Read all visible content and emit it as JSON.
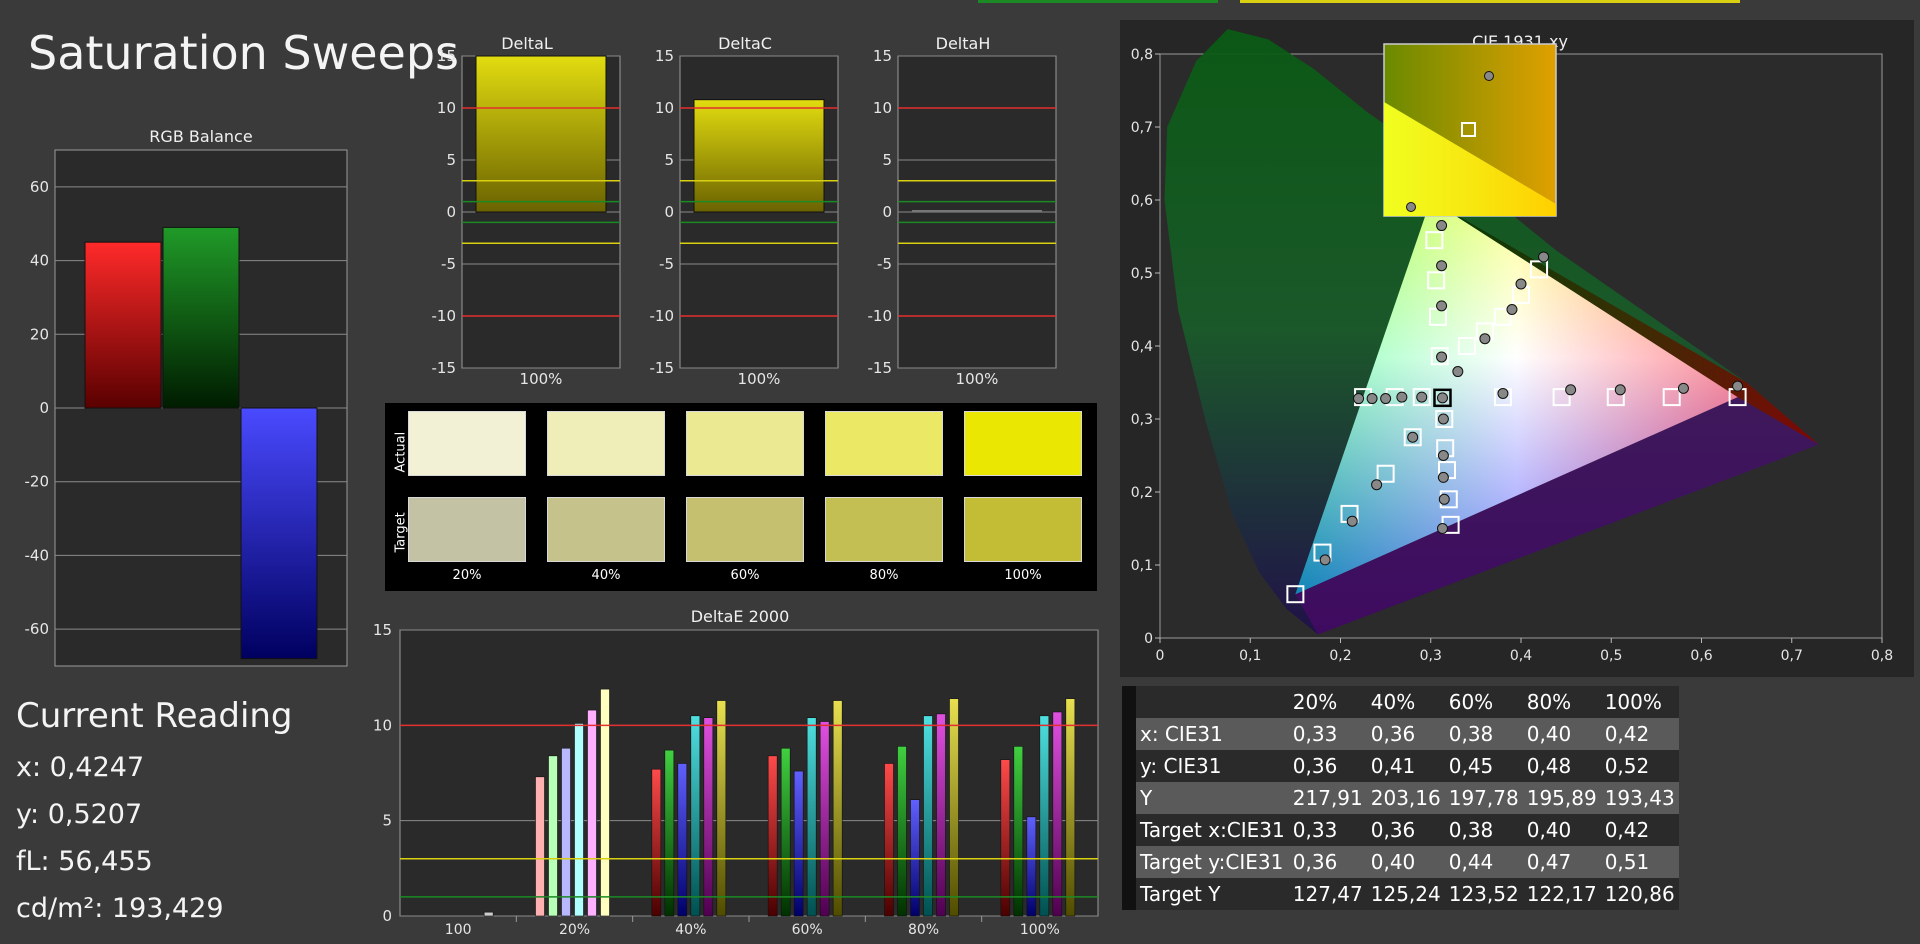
{
  "title": "Saturation Sweeps",
  "current_reading": {
    "heading": "Current Reading",
    "x": "x: 0,4247",
    "y": "y: 0,5207",
    "fl": "fL: 56,455",
    "cdm2": "cd/m²: 193,429"
  },
  "colors": {
    "red": "#e8202a",
    "green": "#1c8a24",
    "blue": "#2a28ff",
    "yellow": "#d8d010",
    "bg": "#2a2a2a"
  },
  "chart_data": [
    {
      "type": "bar",
      "title": "RGB Balance",
      "categories": [
        "100%"
      ],
      "series": [
        {
          "name": "R",
          "values": [
            45
          ]
        },
        {
          "name": "G",
          "values": [
            49
          ]
        },
        {
          "name": "B",
          "values": [
            -68
          ]
        }
      ],
      "ylim": [
        -70,
        70
      ],
      "yticks": [
        60,
        40,
        20,
        0,
        -20,
        -40,
        -60
      ],
      "grid": true
    },
    {
      "type": "bar",
      "title": "DeltaL",
      "categories": [
        "100%"
      ],
      "values": [
        15
      ],
      "ylim": [
        -15,
        15
      ],
      "yticks": [
        15,
        10,
        5,
        0,
        -5,
        -10,
        -15
      ]
    },
    {
      "type": "bar",
      "title": "DeltaC",
      "categories": [
        "100%"
      ],
      "values": [
        10.8
      ],
      "ylim": [
        -15,
        15
      ],
      "yticks": [
        15,
        10,
        5,
        0,
        -5,
        -10,
        -15
      ]
    },
    {
      "type": "bar",
      "title": "DeltaH",
      "categories": [
        "100%"
      ],
      "values": [
        0.1
      ],
      "ylim": [
        -15,
        15
      ],
      "yticks": [
        15,
        10,
        5,
        0,
        -5,
        -10,
        -15
      ]
    },
    {
      "type": "bar",
      "title": "DeltaE 2000",
      "categories": [
        "100",
        "20%",
        "40%",
        "60%",
        "80%",
        "100%"
      ],
      "series": [
        {
          "name": "R",
          "values": [
            0,
            7.3,
            7.7,
            8.4,
            8.0,
            8.2
          ]
        },
        {
          "name": "G",
          "values": [
            0,
            8.4,
            8.7,
            8.8,
            8.9,
            8.9
          ]
        },
        {
          "name": "B",
          "values": [
            0,
            8.8,
            8.0,
            7.6,
            6.1,
            5.2
          ]
        },
        {
          "name": "C",
          "values": [
            0,
            10.1,
            10.5,
            10.4,
            10.5,
            10.5
          ]
        },
        {
          "name": "M",
          "values": [
            0,
            10.8,
            10.4,
            10.2,
            10.6,
            10.7
          ]
        },
        {
          "name": "Y",
          "values": [
            0.2,
            11.9,
            11.3,
            11.3,
            11.4,
            11.4
          ]
        }
      ],
      "ylim": [
        0,
        15
      ],
      "yticks": [
        15,
        10,
        5,
        0
      ]
    },
    {
      "type": "scatter",
      "title": "CIE 1931 xy",
      "xlabel": "",
      "ylabel": "",
      "xlim": [
        0,
        0.8
      ],
      "ylim": [
        0,
        0.8
      ],
      "xticks": [
        "0",
        "0,1",
        "0,2",
        "0,3",
        "0,4",
        "0,5",
        "0,6",
        "0,7",
        "0,8"
      ],
      "yticks": [
        "0",
        "0,1",
        "0,2",
        "0,3",
        "0,4",
        "0,5",
        "0,6",
        "0,7",
        "0,8"
      ],
      "gamut": [
        [
          0.64,
          0.33
        ],
        [
          0.3,
          0.6
        ],
        [
          0.15,
          0.06
        ]
      ],
      "targets": [
        [
          0.313,
          0.329
        ],
        [
          0.38,
          0.33
        ],
        [
          0.445,
          0.33
        ],
        [
          0.505,
          0.33
        ],
        [
          0.567,
          0.33
        ],
        [
          0.64,
          0.33
        ],
        [
          0.31,
          0.386
        ],
        [
          0.308,
          0.44
        ],
        [
          0.306,
          0.49
        ],
        [
          0.304,
          0.545
        ],
        [
          0.3,
          0.6
        ],
        [
          0.28,
          0.275
        ],
        [
          0.25,
          0.225
        ],
        [
          0.21,
          0.17
        ],
        [
          0.18,
          0.117
        ],
        [
          0.15,
          0.06
        ],
        [
          0.29,
          0.33
        ],
        [
          0.26,
          0.33
        ],
        [
          0.225,
          0.33
        ],
        [
          0.315,
          0.3
        ],
        [
          0.316,
          0.26
        ],
        [
          0.318,
          0.23
        ],
        [
          0.32,
          0.19
        ],
        [
          0.322,
          0.155
        ],
        [
          0.34,
          0.4
        ],
        [
          0.36,
          0.42
        ],
        [
          0.38,
          0.44
        ],
        [
          0.4,
          0.47
        ],
        [
          0.42,
          0.505
        ]
      ],
      "measured": [
        [
          0.313,
          0.329
        ],
        [
          0.38,
          0.335
        ],
        [
          0.455,
          0.34
        ],
        [
          0.51,
          0.34
        ],
        [
          0.58,
          0.342
        ],
        [
          0.64,
          0.345
        ],
        [
          0.312,
          0.385
        ],
        [
          0.312,
          0.455
        ],
        [
          0.312,
          0.51
        ],
        [
          0.312,
          0.565
        ],
        [
          0.311,
          0.62
        ],
        [
          0.28,
          0.275
        ],
        [
          0.24,
          0.21
        ],
        [
          0.213,
          0.16
        ],
        [
          0.183,
          0.107
        ],
        [
          0.29,
          0.33
        ],
        [
          0.268,
          0.33
        ],
        [
          0.25,
          0.328
        ],
        [
          0.235,
          0.328
        ],
        [
          0.22,
          0.328
        ],
        [
          0.314,
          0.3
        ],
        [
          0.314,
          0.25
        ],
        [
          0.314,
          0.22
        ],
        [
          0.315,
          0.19
        ],
        [
          0.313,
          0.15
        ],
        [
          0.33,
          0.365
        ],
        [
          0.36,
          0.41
        ],
        [
          0.39,
          0.45
        ],
        [
          0.4,
          0.485
        ],
        [
          0.425,
          0.522
        ]
      ],
      "inset_points": {
        "target": [
          0.4247,
          0.5207
        ],
        "measured": [
          [
            0.436,
            0.539
          ],
          [
            0.412,
            0.49
          ]
        ]
      }
    }
  ],
  "table": {
    "headers": [
      "",
      "20%",
      "40%",
      "60%",
      "80%",
      "100%"
    ],
    "rows": [
      [
        "x: CIE31",
        "0,33",
        "0,36",
        "0,38",
        "0,40",
        "0,42"
      ],
      [
        "y: CIE31",
        "0,36",
        "0,41",
        "0,45",
        "0,48",
        "0,52"
      ],
      [
        "Y",
        "217,91",
        "203,16",
        "197,78",
        "195,89",
        "193,43"
      ],
      [
        "Target x:CIE31",
        "0,33",
        "0,36",
        "0,38",
        "0,40",
        "0,42"
      ],
      [
        "Target y:CIE31",
        "0,36",
        "0,40",
        "0,44",
        "0,47",
        "0,51"
      ],
      [
        "Target Y",
        "127,47",
        "125,24",
        "123,52",
        "122,17",
        "120,86"
      ]
    ]
  },
  "swatches": {
    "row_labels": [
      "Actual",
      "Target"
    ],
    "labels": [
      "20%",
      "40%",
      "60%",
      "80%",
      "100%"
    ],
    "actual": [
      "#f2f1d6",
      "#efeeb8",
      "#ebea92",
      "#eae865",
      "#eae803"
    ],
    "target": [
      "#c3c2a5",
      "#c5c28c",
      "#c5c070",
      "#c3bf52",
      "#c2bd34"
    ]
  }
}
